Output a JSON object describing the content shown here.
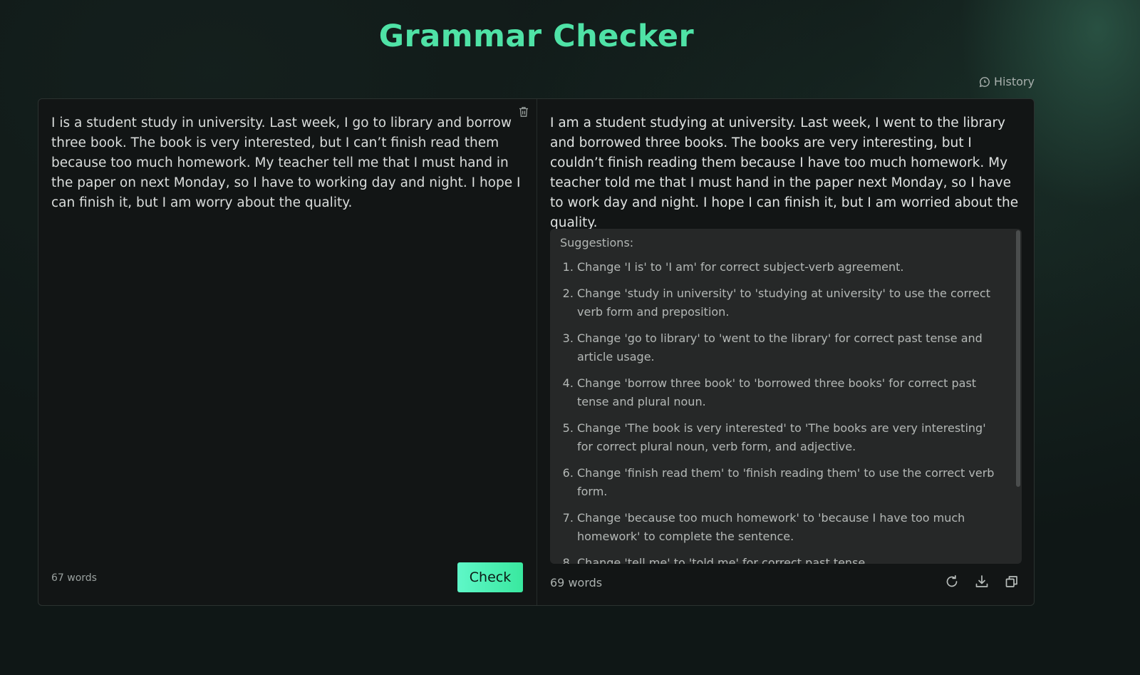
{
  "app": {
    "title": "Grammar Checker",
    "history_label": "History"
  },
  "input": {
    "text": "I is a student study in university. Last week, I go to library and borrow three book. The book is very interested, but I can’t finish read them because too much homework. My teacher tell me that I must hand in the paper on next Monday, so I have to working day and night. I hope I can finish it, but I am worry about the quality.",
    "word_count": "67 words",
    "check_label": "Check"
  },
  "output": {
    "text": "I am a student studying at university. Last week, I went to the library and borrowed three books. The books are very interesting, but I couldn’t finish reading them because I have too much homework. My teacher told me that I must hand in the paper next Monday, so I have to work day and night. I hope I can finish it, but I am worried about the quality.",
    "word_count": "69 words",
    "suggestions_title": "Suggestions:",
    "suggestions": [
      "Change 'I is' to 'I am' for correct subject-verb agreement.",
      "Change 'study in university' to 'studying at university' to use the correct verb form and preposition.",
      "Change 'go to library' to 'went to the library' for correct past tense and article usage.",
      "Change 'borrow three book' to 'borrowed three books' for correct past tense and plural noun.",
      "Change 'The book is very interested' to 'The books are very interesting' for correct plural noun, verb form, and adjective.",
      "Change 'finish read them' to 'finish reading them' to use the correct verb form.",
      "Change 'because too much homework' to 'because I have too much homework' to complete the sentence.",
      "Change 'tell me' to 'told me' for correct past tense."
    ]
  },
  "icons": {
    "history": "chat-bubble-icon",
    "clear": "trash-icon",
    "regenerate": "refresh-icon",
    "download": "download-icon",
    "copy": "copy-icon"
  },
  "colors": {
    "accent": "#4fe2a6",
    "button_gradient_start": "#5ff7c8",
    "button_gradient_end": "#39e89f",
    "background": "#0f1716",
    "panel": "#121515",
    "suggestions_bg": "#262828"
  }
}
